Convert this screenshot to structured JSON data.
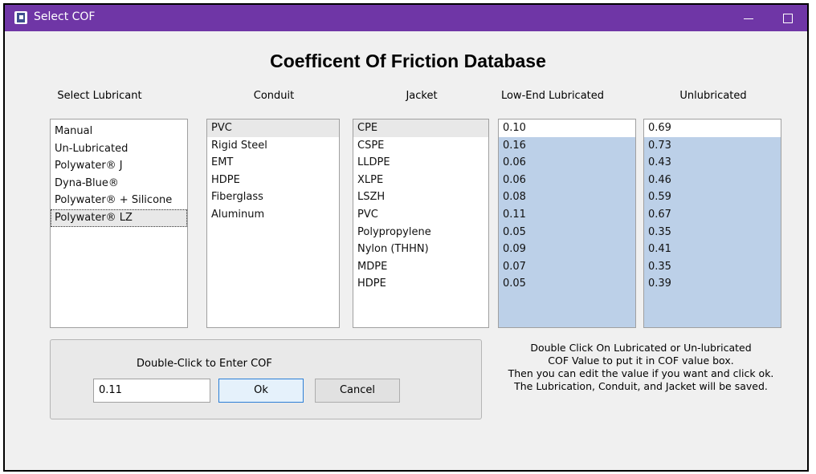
{
  "window": {
    "title": "Select COF",
    "title_bar_color": "#6f36a6"
  },
  "heading": "Coefficent Of Friction Database",
  "columns": {
    "lubricant": "Select Lubricant",
    "conduit": "Conduit",
    "jacket": "Jacket",
    "low_end": "Low-End Lubricated",
    "unlubricated": "Unlubricated"
  },
  "lubricants": [
    "Manual",
    "Un-Lubricated",
    "Polywater® J",
    "Dyna-Blue®",
    "Polywater® + Silicone",
    "Polywater® LZ"
  ],
  "selected_lubricant": "Polywater® LZ",
  "conduits": [
    "PVC",
    "Rigid Steel",
    "EMT",
    "HDPE",
    "Fiberglass",
    "Aluminum"
  ],
  "selected_conduit": "PVC",
  "jackets": [
    "CPE",
    "CSPE",
    "LLDPE",
    "XLPE",
    "LSZH",
    "PVC",
    "Polypropylene",
    "Nylon (THHN)",
    "MDPE",
    "HDPE"
  ],
  "selected_jacket": "CPE",
  "low_end_values": [
    "0.10",
    "0.16",
    "0.06",
    "0.06",
    "0.08",
    "0.11",
    "0.05",
    "0.09",
    "0.07",
    "0.05"
  ],
  "unlubricated_values": [
    "0.69",
    "0.73",
    "0.43",
    "0.46",
    "0.59",
    "0.67",
    "0.35",
    "0.41",
    "0.35",
    "0.39"
  ],
  "entry": {
    "label": "Double-Click to Enter COF",
    "value": "0.11",
    "ok_label": "Ok",
    "cancel_label": "Cancel"
  },
  "instructions": [
    "Double Click On Lubricated or Un-lubricated",
    "COF Value to put it in COF value box.",
    "Then you can edit the value if you want and click ok.",
    "The Lubrication, Conduit, and Jacket will be saved."
  ],
  "list_colors": {
    "values_bg": "#bcd0e8"
  }
}
